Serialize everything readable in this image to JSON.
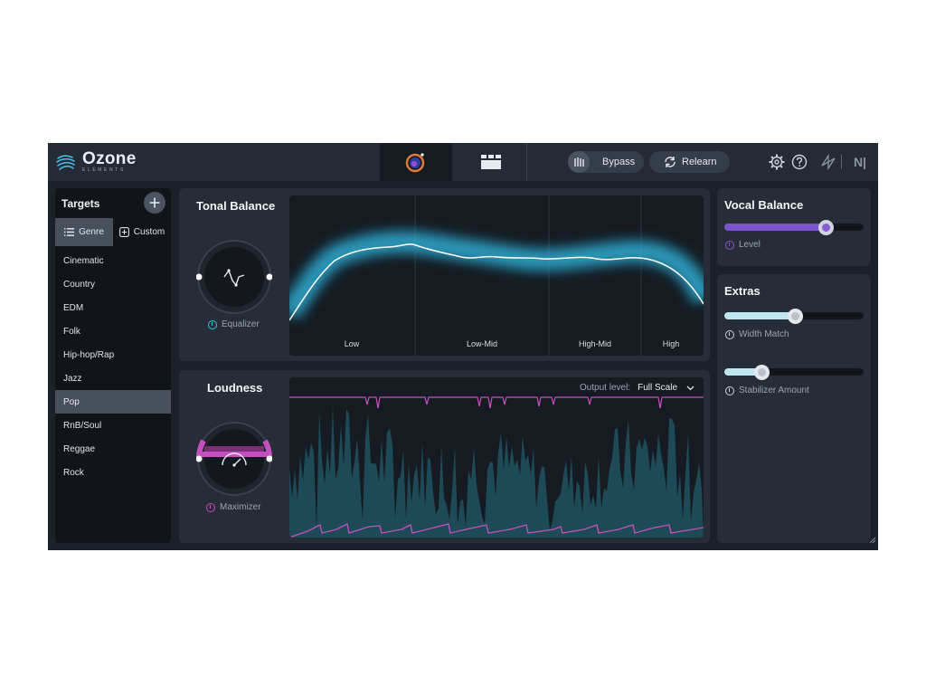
{
  "header": {
    "logo_title": "Ozone",
    "logo_subtitle": "ELEMENTS",
    "bypass_label": "Bypass",
    "relearn_label": "Relearn",
    "ni_label": "N|"
  },
  "targets": {
    "title": "Targets",
    "genre_tab": "Genre",
    "custom_tab": "Custom",
    "genres": [
      "Cinematic",
      "Country",
      "EDM",
      "Folk",
      "Hip-hop/Rap",
      "Jazz",
      "Pop",
      "RnB/Soul",
      "Reggae",
      "Rock"
    ],
    "selected": "Pop"
  },
  "tonal_balance": {
    "title": "Tonal Balance",
    "knob_label": "Equalizer",
    "bands": [
      "Low",
      "Low-Mid",
      "High-Mid",
      "High"
    ]
  },
  "loudness": {
    "title": "Loudness",
    "knob_label": "Maximizer",
    "output_label": "Output level:",
    "output_value": "Full Scale"
  },
  "vocal_balance": {
    "title": "Vocal Balance",
    "slider_label": "Level",
    "level": 0.73
  },
  "extras": {
    "title": "Extras",
    "width_match_label": "Width Match",
    "width_match": 0.51,
    "stabilizer_label": "Stabilizer Amount",
    "stabilizer": 0.27
  },
  "colors": {
    "accent_cyan": "#2ec4e8",
    "accent_magenta": "#c64fc0",
    "accent_purple": "#8a5cd8",
    "panel": "#262d36",
    "background": "#1b2129"
  }
}
